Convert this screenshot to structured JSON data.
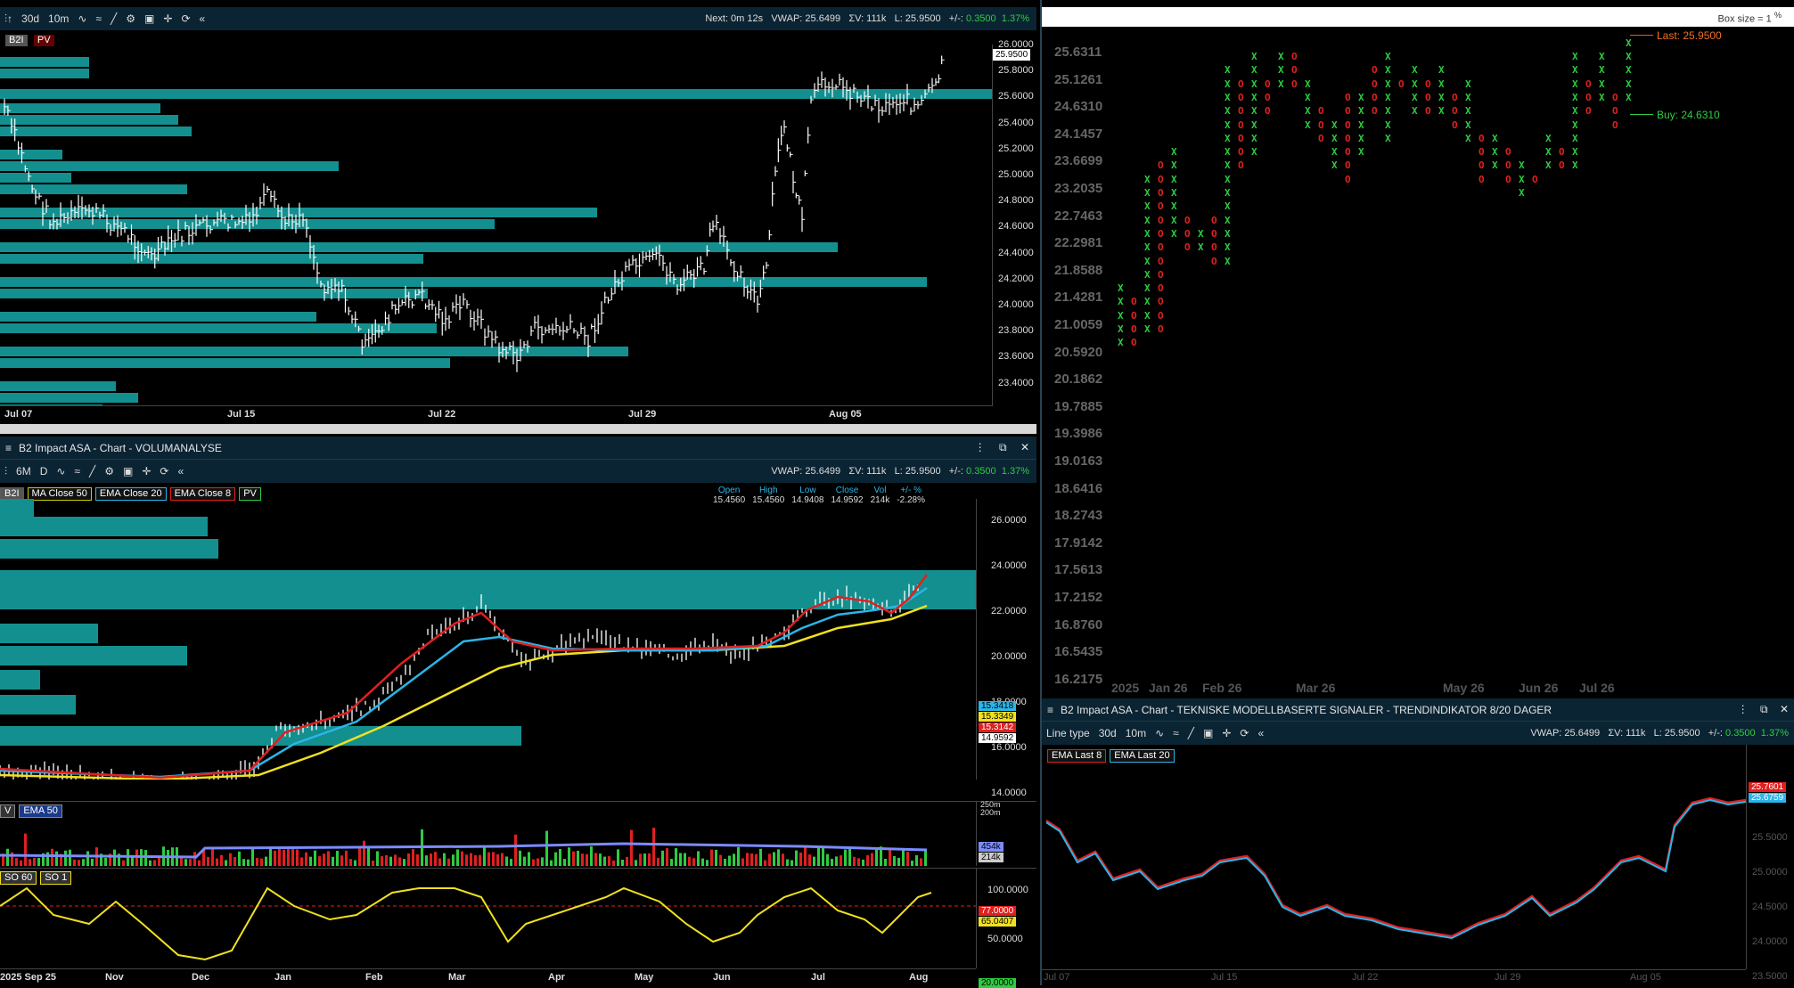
{
  "top_left": {
    "toolbar": {
      "range1": "30d",
      "range2": "10m"
    },
    "status": {
      "next": "Next: 0m 12s",
      "vwap": "VWAP: 25.6499",
      "vol": "ΣV: 111k",
      "last": "L: 25.9500",
      "chg_label": "+/-:",
      "chg": "0.3500",
      "pct": "1.37%"
    },
    "tags": [
      "B2I",
      "PV"
    ],
    "y_ticks": [
      "26.0000",
      "25.8000",
      "25.6000",
      "25.4000",
      "25.2000",
      "25.0000",
      "24.8000",
      "24.6000",
      "24.4000",
      "24.2000",
      "24.0000",
      "23.8000",
      "23.6000",
      "23.4000"
    ],
    "price_badge": "25.9500",
    "x_ticks": [
      "Jul 07",
      "Jul 15",
      "Jul 22",
      "Jul 29",
      "Aug 05"
    ]
  },
  "pnf": {
    "box_size": "Box size = 1",
    "box_unit": "%",
    "y_ticks": [
      "25.6311",
      "25.1261",
      "24.6310",
      "24.1457",
      "23.6699",
      "23.2035",
      "22.7463",
      "22.2981",
      "21.8588",
      "21.4281",
      "21.0059",
      "20.5920",
      "20.1862",
      "19.7885",
      "19.3986",
      "19.0163",
      "18.6416",
      "18.2743",
      "17.9142",
      "17.5613",
      "17.2152",
      "16.8760",
      "16.5435",
      "16.2175"
    ],
    "x_ticks": [
      "2025",
      "Jan 26",
      "Feb 26",
      "Mar 26",
      "May 26",
      "Jun 26",
      "Jul 26"
    ],
    "last_label": "Last: 25.9500",
    "buy_label": "Buy: 24.6310"
  },
  "mid_left": {
    "title": "B2 Impact ASA - Chart - VOLUMANALYSE",
    "toolbar": {
      "range1": "6M",
      "range2": "D"
    },
    "status": {
      "vwap": "VWAP: 25.6499",
      "vol": "ΣV: 111k",
      "last": "L: 25.9500",
      "chg_label": "+/-:",
      "chg": "0.3500",
      "pct": "1.37%"
    },
    "tags": [
      {
        "t": "B2I",
        "c": "#5a5a5a"
      },
      {
        "t": "MA  Close 50",
        "c": "#c9c900"
      },
      {
        "t": "EMA  Close 20",
        "c": "#2bb5e8"
      },
      {
        "t": "EMA  Close 8",
        "c": "#e02020"
      },
      {
        "t": "PV",
        "c": "#2ecc40"
      }
    ],
    "ohlc_head": [
      "Open",
      "High",
      "Low",
      "Close",
      "Vol",
      "+/- %"
    ],
    "ohlc_vals": [
      "15.4560",
      "15.4560",
      "14.9408",
      "14.9592",
      "214k",
      "-2.28%"
    ],
    "y_ticks": [
      "26.0000",
      "24.0000",
      "22.0000",
      "20.0000",
      "18.0000",
      "16.0000",
      "14.0000"
    ],
    "badges": [
      "15.3418",
      "15.3349",
      "15.3142",
      "14.9592"
    ],
    "vol_tags": [
      "V",
      "EMA  50"
    ],
    "vol_ticks": [
      "250m",
      "200m"
    ],
    "vol_badges": [
      "454k",
      "214k"
    ],
    "so_tags": [
      "SO  60",
      "SO  1"
    ],
    "so_ticks": [
      "100.0000",
      "50.0000"
    ],
    "so_badges": [
      "77.0000",
      "65.0407",
      "20.0000"
    ],
    "x_ticks": [
      "2025 Sep 25",
      "Nov",
      "Dec",
      "Jan",
      "Feb",
      "Mar",
      "Apr",
      "May",
      "Jun",
      "Jul",
      "Aug"
    ]
  },
  "bot_right": {
    "title": "B2 Impact ASA - Chart - TEKNISKE MODELLBASERTE SIGNALER - TRENDINDIKATOR 8/20 DAGER",
    "toolbar": {
      "linetype": "Line type",
      "range1": "30d",
      "range2": "10m"
    },
    "status": {
      "vwap": "VWAP: 25.6499",
      "vol": "ΣV: 111k",
      "last": "L: 25.9500",
      "chg_label": "+/-:",
      "chg": "0.3500",
      "pct": "1.37%"
    },
    "tags": [
      {
        "t": "EMA  Last 8",
        "c": "#e02020"
      },
      {
        "t": "EMA  Last 20",
        "c": "#2bb5e8"
      }
    ],
    "y_ticks": [
      "25.5000",
      "25.0000",
      "24.5000",
      "24.0000",
      "23.5000"
    ],
    "badges": [
      "25.7601",
      "25.6759"
    ],
    "x_ticks": [
      "Jul 07",
      "Jul 15",
      "Jul 22",
      "Jul 29",
      "Aug 05"
    ]
  },
  "colors": {
    "panel_bg": "#0b2433",
    "teal": "#148f8f",
    "up": "#2ecc40",
    "down": "#e02020",
    "yellow": "#f0e020",
    "blue": "#2bb5e8"
  }
}
